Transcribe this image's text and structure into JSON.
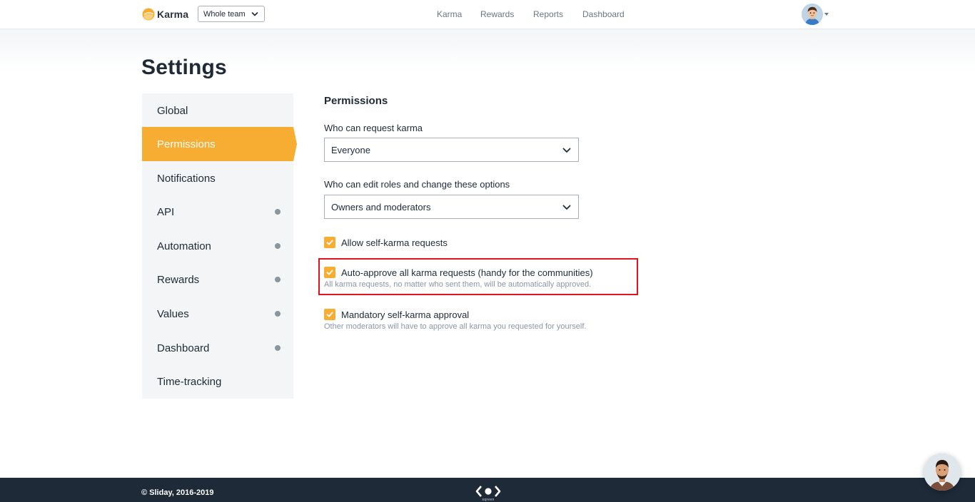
{
  "header": {
    "logo_text": "Karma",
    "team_select": "Whole team",
    "nav": [
      "Karma",
      "Rewards",
      "Reports",
      "Dashboard"
    ]
  },
  "page_title": "Settings",
  "sidebar": {
    "items": [
      {
        "label": "Global",
        "dot": false,
        "active": false
      },
      {
        "label": "Permissions",
        "dot": false,
        "active": true
      },
      {
        "label": "Notifications",
        "dot": false,
        "active": false
      },
      {
        "label": "API",
        "dot": true,
        "active": false
      },
      {
        "label": "Automation",
        "dot": true,
        "active": false
      },
      {
        "label": "Rewards",
        "dot": true,
        "active": false
      },
      {
        "label": "Values",
        "dot": true,
        "active": false
      },
      {
        "label": "Dashboard",
        "dot": true,
        "active": false
      },
      {
        "label": "Time-tracking",
        "dot": false,
        "active": false
      }
    ]
  },
  "permissions": {
    "title": "Permissions",
    "request_label": "Who can request karma",
    "request_value": "Everyone",
    "edit_label": "Who can edit roles and change these options",
    "edit_value": "Owners and moderators",
    "options": [
      {
        "label": "Allow self-karma requests",
        "help": "",
        "checked": true
      },
      {
        "label": "Auto-approve all karma requests (handy for the communities)",
        "help": "All karma requests, no matter who sent them, will be automatically approved.",
        "checked": true
      },
      {
        "label": "Mandatory self-karma approval",
        "help": "Other moderators will have to approve all karma you requested for yourself.",
        "checked": true
      }
    ]
  },
  "footer": {
    "copyright": "© Sliday, 2016-2019",
    "logo_caption": "sqreen"
  },
  "colors": {
    "accent": "#f7ac32",
    "highlight": "#e0141c",
    "footer_bg": "#1e2a38"
  }
}
